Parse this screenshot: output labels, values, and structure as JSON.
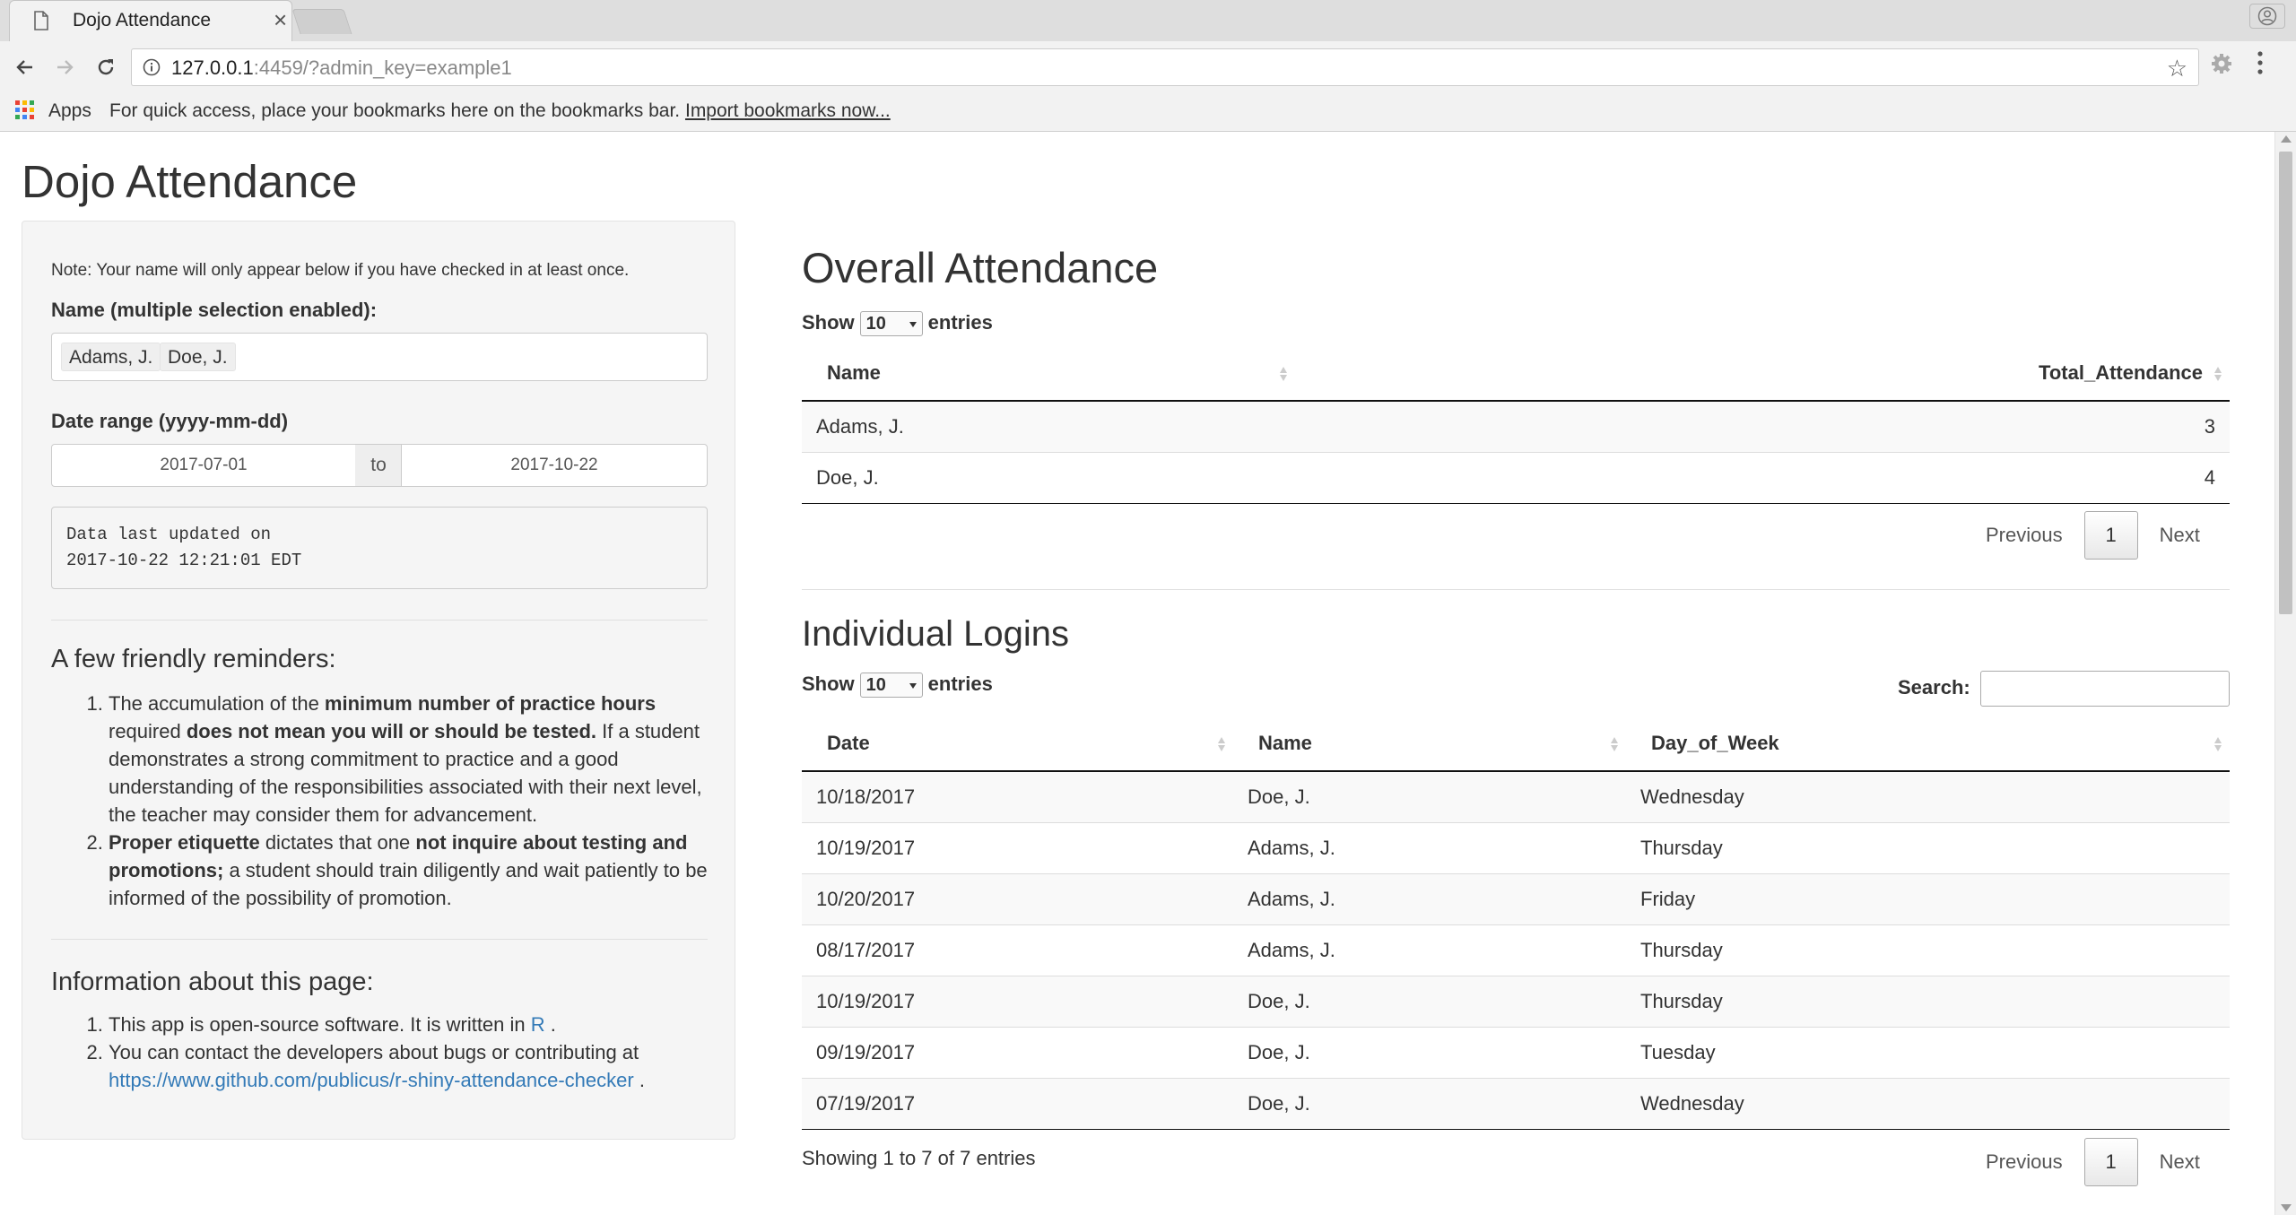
{
  "browser": {
    "tab_title": "Dojo Attendance",
    "url_host": "127.0.0.1",
    "url_rest": ":4459/?admin_key=example1",
    "bookmarks": {
      "apps_label": "Apps",
      "text": "For quick access, place your bookmarks here on the bookmarks bar.",
      "import_link": "Import bookmarks now..."
    }
  },
  "page": {
    "title": "Dojo Attendance"
  },
  "sidebar": {
    "note": "Note: Your name will only appear below if you have checked in at least once.",
    "name_label": "Name (multiple selection enabled):",
    "selected_names": [
      "Adams, J.",
      "Doe, J."
    ],
    "date_label": "Date range (yyyy-mm-dd)",
    "date_start": "2017-07-01",
    "date_sep": "to",
    "date_end": "2017-10-22",
    "updated_line1": "Data last updated on",
    "updated_line2": "2017-10-22 12:21:01 EDT",
    "reminders_title": "A few friendly reminders:",
    "reminder1": {
      "p1": "The accumulation of the ",
      "b1": "minimum number of practice hours",
      "p2": " required ",
      "b2": "does not mean you will or should be tested.",
      "p3": " If a student demonstrates a strong commitment to practice and a good understanding of the responsibilities associated with their next level, the teacher may consider them for advancement."
    },
    "reminder2": {
      "b1": "Proper etiquette",
      "p1": " dictates that one ",
      "b2": "not inquire about testing and promotions;",
      "p2": " a student should train diligently and wait patiently to be informed of the possibility of promotion."
    },
    "info_title": "Information about this page:",
    "info1_text": "This app is open-source software. It is written in ",
    "info1_link": "R",
    "info1_end": " .",
    "info2_text": "You can contact the developers about bugs or contributing at ",
    "info2_link": "https://www.github.com/publicus/r-shiny-attendance-checker",
    "info2_end": " ."
  },
  "overall": {
    "title": "Overall Attendance",
    "show_label": "Show",
    "entries_value": "10",
    "entries_label": "entries",
    "columns": [
      "Name",
      "Total_Attendance"
    ],
    "rows": [
      [
        "Adams, J.",
        "3"
      ],
      [
        "Doe, J.",
        "4"
      ]
    ],
    "prev": "Previous",
    "page": "1",
    "next": "Next"
  },
  "logins": {
    "title": "Individual Logins",
    "show_label": "Show",
    "entries_value": "10",
    "entries_label": "entries",
    "search_label": "Search:",
    "columns": [
      "Date",
      "Name",
      "Day_of_Week"
    ],
    "rows": [
      [
        "10/18/2017",
        "Doe, J.",
        "Wednesday"
      ],
      [
        "10/19/2017",
        "Adams, J.",
        "Thursday"
      ],
      [
        "10/20/2017",
        "Adams, J.",
        "Friday"
      ],
      [
        "08/17/2017",
        "Adams, J.",
        "Thursday"
      ],
      [
        "10/19/2017",
        "Doe, J.",
        "Thursday"
      ],
      [
        "09/19/2017",
        "Doe, J.",
        "Tuesday"
      ],
      [
        "07/19/2017",
        "Doe, J.",
        "Wednesday"
      ]
    ],
    "info": "Showing 1 to 7 of 7 entries",
    "prev": "Previous",
    "page": "1",
    "next": "Next"
  }
}
